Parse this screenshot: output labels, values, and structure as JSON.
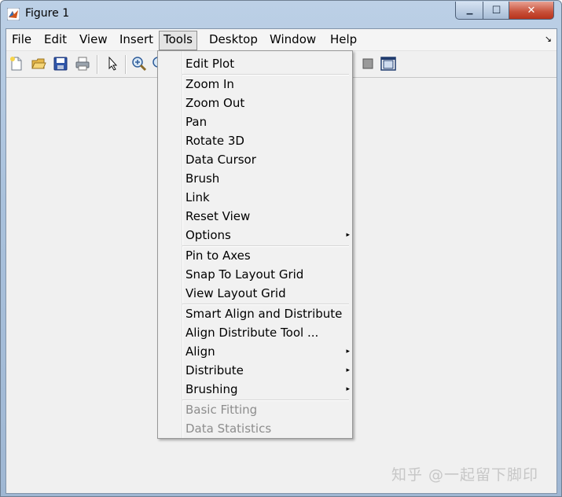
{
  "window": {
    "title": "Figure 1",
    "controls": {
      "minimize": "▁",
      "maximize": "☐",
      "close": "✕"
    }
  },
  "menubar": {
    "items": [
      "File",
      "Edit",
      "View",
      "Insert",
      "Tools",
      "Desktop",
      "Window",
      "Help"
    ],
    "active": "Tools",
    "dock_glyph": "↘"
  },
  "toolbar": {
    "icons": [
      "new-figure-icon",
      "open-file-icon",
      "save-icon",
      "print-icon",
      "pointer-icon",
      "zoom-in-icon",
      "zoom-out-icon",
      "colorbar-icon",
      "plot-tools-icon"
    ]
  },
  "tools_menu": {
    "groups": [
      [
        {
          "label": "Edit Plot"
        }
      ],
      [
        {
          "label": "Zoom In"
        },
        {
          "label": "Zoom Out"
        },
        {
          "label": "Pan"
        },
        {
          "label": "Rotate 3D"
        },
        {
          "label": "Data Cursor"
        },
        {
          "label": "Brush"
        },
        {
          "label": "Link"
        },
        {
          "label": "Reset View"
        },
        {
          "label": "Options",
          "submenu": true
        }
      ],
      [
        {
          "label": "Pin to Axes"
        },
        {
          "label": "Snap To Layout Grid"
        },
        {
          "label": "View Layout Grid"
        }
      ],
      [
        {
          "label": "Smart Align and Distribute"
        },
        {
          "label": "Align Distribute Tool ..."
        },
        {
          "label": "Align",
          "submenu": true
        },
        {
          "label": "Distribute",
          "submenu": true
        },
        {
          "label": "Brushing",
          "submenu": true
        }
      ],
      [
        {
          "label": "Basic Fitting",
          "disabled": true
        },
        {
          "label": "Data Statistics",
          "disabled": true
        }
      ]
    ],
    "submenu_glyph": "▸"
  },
  "watermark": "知乎 @一起留下脚印",
  "colors": {
    "titlebar": "#a9c1dc",
    "close_button": "#c75039",
    "menu_bg": "#f1f1f1",
    "disabled_text": "#8d8d8d"
  }
}
